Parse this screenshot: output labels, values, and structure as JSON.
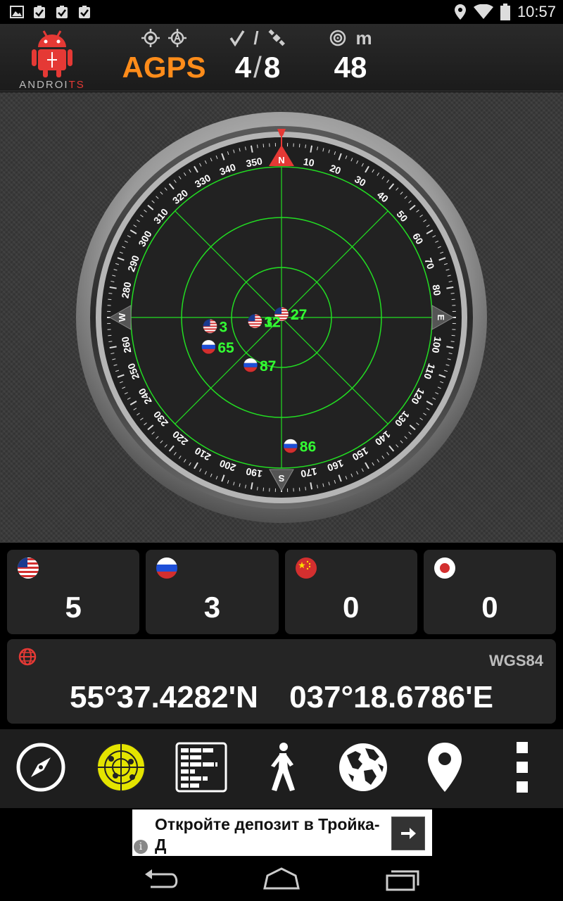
{
  "status_bar": {
    "left_icons": [
      "image-icon",
      "clipboard-check-icon",
      "clipboard-check-icon",
      "clipboard-check-icon"
    ],
    "right_icons": [
      "location-pin-icon",
      "wifi-icon",
      "battery-icon"
    ],
    "time": "10:57"
  },
  "header": {
    "logo_text_main": "ANDROI",
    "logo_text_accent": "TS",
    "fix_mode": "AGPS",
    "satellites_used": "4",
    "satellites_sep": "/",
    "satellites_visible": "8",
    "accuracy_unit": "m",
    "accuracy": "48",
    "fix_icons": [
      "crosshair-icon",
      "agps-icon"
    ],
    "sat_icons": [
      "checkmark-icon",
      "satellite-icon"
    ],
    "accuracy_icons": [
      "accuracy-icon"
    ]
  },
  "compass": {
    "cardinals": {
      "n": "N",
      "e": "E",
      "s": "S",
      "w": "W"
    },
    "degree_labels": [
      "10",
      "20",
      "30",
      "40",
      "50",
      "60",
      "70",
      "80",
      "100",
      "110",
      "120",
      "130",
      "140",
      "150",
      "160",
      "170",
      "190",
      "200",
      "210",
      "220",
      "230",
      "240",
      "250",
      "260",
      "280",
      "290",
      "300",
      "310",
      "320",
      "330",
      "340",
      "350"
    ],
    "satellites": [
      {
        "prn": "27",
        "flag": "us",
        "azimuth": 0,
        "elevation": 88
      },
      {
        "prn": "2",
        "flag": "us",
        "azimuth": 0,
        "elevation": 88
      },
      {
        "prn": "3",
        "flag": "us",
        "azimuth": 263,
        "elevation": 47
      },
      {
        "prn": "32",
        "flag": "us",
        "azimuth": 262,
        "elevation": 74
      },
      {
        "prn": "12",
        "flag": "us",
        "azimuth": 262,
        "elevation": 74
      },
      {
        "prn": "65",
        "flag": "ru",
        "azimuth": 248,
        "elevation": 43
      },
      {
        "prn": "87",
        "flag": "ru",
        "azimuth": 213,
        "elevation": 56
      },
      {
        "prn": "86",
        "flag": "ru",
        "azimuth": 176,
        "elevation": 13
      }
    ]
  },
  "counts": [
    {
      "flag": "us",
      "value": "5"
    },
    {
      "flag": "ru",
      "value": "3"
    },
    {
      "flag": "cn",
      "value": "0"
    },
    {
      "flag": "jp",
      "value": "0"
    }
  ],
  "position": {
    "datum": "WGS84",
    "latitude": "55°37.4282'N",
    "longitude": "037°18.6786'E"
  },
  "toolbar": [
    "compass-icon",
    "radar-icon",
    "signal-bars-icon",
    "walking-icon",
    "globe-icon",
    "map-pin-icon",
    "more-icon"
  ],
  "ad": {
    "text": "Откройте депозит в Тройка-Д",
    "info": "i"
  },
  "colors": {
    "accent_orange": "#ff8c1a",
    "radar_green": "#22dd22",
    "label_green": "#33ff33",
    "north_red": "#e53935"
  }
}
